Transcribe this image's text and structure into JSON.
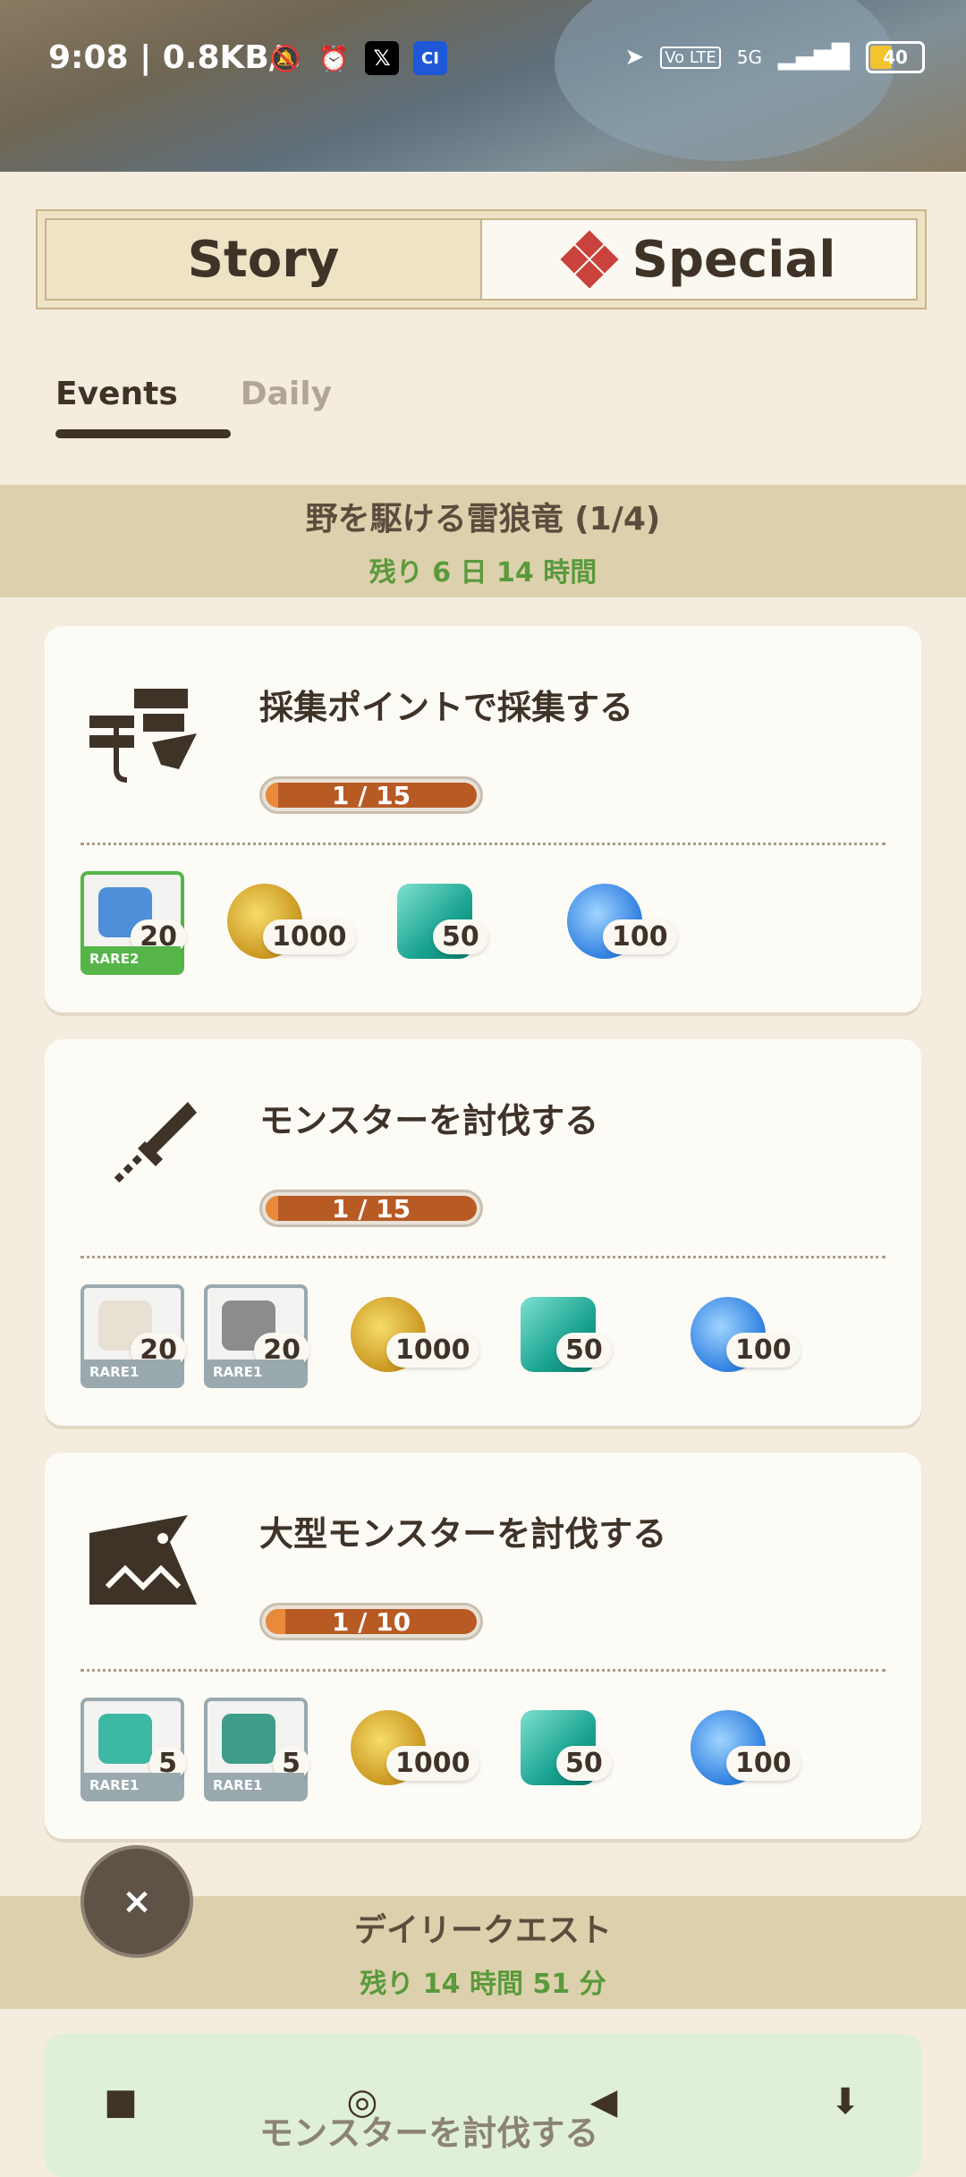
{
  "status_bar": {
    "time": "9:08 | 0.8KB/s",
    "x_icon": "𝕏",
    "ci_icon": "CI",
    "volte": "Vo LTE",
    "network": "5G",
    "battery": "40"
  },
  "mode_toggle": {
    "story_label": "Story",
    "special_label": "Special",
    "active": "Special"
  },
  "sub_tabs": {
    "events": "Events",
    "daily": "Daily",
    "active": "Events"
  },
  "event_section": {
    "title": "野を駆ける雷狼竜 (1/4)",
    "time_left": "残り 6 日 14 時間"
  },
  "quests": [
    {
      "title": "採集ポイントで採集する",
      "progress": "1 / 15",
      "progress_value": 0.067,
      "items": [
        {
          "rarity": "RARE2",
          "qty": "20",
          "art": "blue-ore"
        }
      ],
      "currencies": [
        {
          "type": "gold-coin",
          "qty": "1000"
        },
        {
          "type": "green-gem",
          "qty": "50"
        },
        {
          "type": "blue-orb",
          "qty": "100"
        }
      ]
    },
    {
      "title": "モンスターを討伐する",
      "progress": "1 / 15",
      "progress_value": 0.067,
      "items": [
        {
          "rarity": "RARE1",
          "qty": "20",
          "art": "white-horn"
        },
        {
          "rarity": "RARE1",
          "qty": "20",
          "art": "grey-figure"
        }
      ],
      "currencies": [
        {
          "type": "gold-coin",
          "qty": "1000"
        },
        {
          "type": "green-gem",
          "qty": "50"
        },
        {
          "type": "blue-orb",
          "qty": "100"
        }
      ]
    },
    {
      "title": "大型モンスターを討伐する",
      "progress": "1 / 10",
      "progress_value": 0.1,
      "items": [
        {
          "rarity": "RARE1",
          "qty": "5",
          "art": "teal-fang"
        },
        {
          "rarity": "RARE1",
          "qty": "5",
          "art": "teal-scale"
        }
      ],
      "currencies": [
        {
          "type": "gold-coin",
          "qty": "1000"
        },
        {
          "type": "green-gem",
          "qty": "50"
        },
        {
          "type": "blue-orb",
          "qty": "100"
        }
      ]
    }
  ],
  "close_label": "×",
  "daily_section": {
    "title": "デイリークエスト",
    "time_left": "残り 14 時間 51 分"
  },
  "bottom_card_title": "モンスターを討伐する",
  "nav": {
    "recents": "■",
    "home": "◎",
    "back": "◀",
    "assist": "⬇"
  },
  "colors": {
    "accent_green": "#5a9a3c",
    "progress_fill": "#b85a24",
    "rare2": "#55b548",
    "rare1": "#9aa9ae"
  }
}
